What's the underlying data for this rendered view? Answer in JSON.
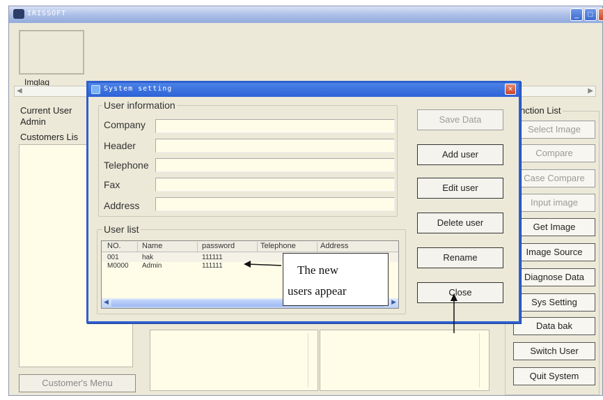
{
  "main_window": {
    "title": "IRISSOFT",
    "window_buttons": [
      "_",
      "□",
      "×"
    ]
  },
  "left_panel": {
    "image_label": "Imglag",
    "current_user_label": "Current User",
    "current_user_value": "Admin",
    "customers_list_label": "Customers Lis",
    "customer_menu_button": "Customer's Menu"
  },
  "function_list": {
    "title": "nction List",
    "buttons": [
      {
        "label": "Select Image",
        "enabled": false
      },
      {
        "label": "Compare",
        "enabled": false
      },
      {
        "label": "Case Compare",
        "enabled": false
      },
      {
        "label": "Input image",
        "enabled": false
      },
      {
        "label": "Get Image",
        "enabled": true
      },
      {
        "label": "Image Source",
        "enabled": true
      },
      {
        "label": "Diagnose Data",
        "enabled": true
      },
      {
        "label": "Sys Setting",
        "enabled": true
      },
      {
        "label": "Data bak",
        "enabled": true
      },
      {
        "label": "Switch User",
        "enabled": true
      },
      {
        "label": "Quit System",
        "enabled": true
      }
    ]
  },
  "dialog": {
    "title": "System setting",
    "close_symbol": "×",
    "user_information": {
      "title": "User information",
      "fields": [
        {
          "label": "Company",
          "value": ""
        },
        {
          "label": "Header",
          "value": ""
        },
        {
          "label": "Telephone",
          "value": ""
        },
        {
          "label": "Fax",
          "value": ""
        },
        {
          "label": "Address",
          "value": ""
        }
      ]
    },
    "user_list": {
      "title": "User list",
      "columns": [
        "NO.",
        "Name",
        "password",
        "Telephone",
        "Address"
      ],
      "rows": [
        [
          "001",
          "hak",
          "111111",
          "",
          ""
        ],
        [
          "M0000",
          "Admin",
          "111111",
          "",
          ""
        ]
      ]
    },
    "buttons": [
      {
        "label": "Save Data",
        "enabled": false
      },
      {
        "label": "Add user",
        "enabled": true
      },
      {
        "label": "Edit user",
        "enabled": true
      },
      {
        "label": "Delete user",
        "enabled": true
      },
      {
        "label": "Rename",
        "enabled": true
      },
      {
        "label": "Close",
        "enabled": true
      }
    ]
  },
  "annotation": {
    "line1": "The new",
    "line2": "users appear"
  },
  "colors": {
    "window_bg": "#ece9d8",
    "dialog_border": "#2f5fcf",
    "input_bg": "#fffde8"
  }
}
